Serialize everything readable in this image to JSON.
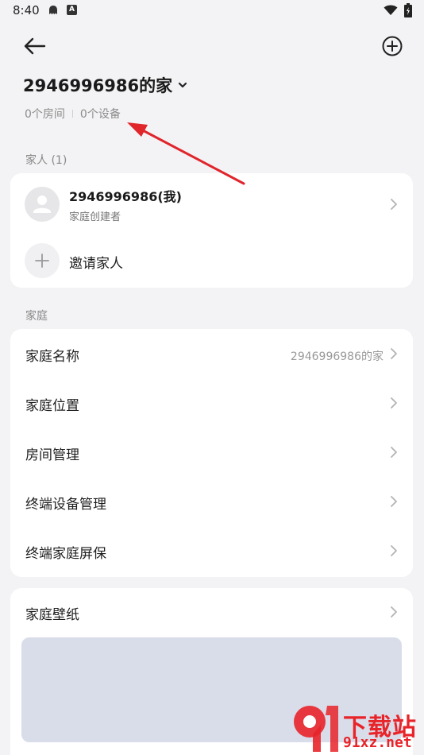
{
  "status_bar": {
    "time": "8:40"
  },
  "header": {
    "home_title": "2946996986的家",
    "room_count": "0个房间",
    "device_count": "0个设备"
  },
  "family_section": {
    "label": "家人 (1)",
    "member": {
      "name": "2946996986(我)",
      "role": "家庭创建者"
    },
    "invite_label": "邀请家人"
  },
  "home_section": {
    "label": "家庭",
    "items": [
      {
        "label": "家庭名称",
        "value": "2946996986的家"
      },
      {
        "label": "家庭位置",
        "value": ""
      },
      {
        "label": "房间管理",
        "value": ""
      },
      {
        "label": "终端设备管理",
        "value": ""
      },
      {
        "label": "终端家庭屏保",
        "value": ""
      }
    ]
  },
  "wallpaper_section": {
    "label": "家庭壁纸"
  },
  "annotation": {
    "arrow_color": "#e0252b"
  },
  "watermark": {
    "top_text": "下载站",
    "bottom_text": "91xz.net"
  },
  "colors": {
    "background": "#f3f3f5",
    "card": "#ffffff",
    "wallpaper_preview": "#d9dde9"
  }
}
